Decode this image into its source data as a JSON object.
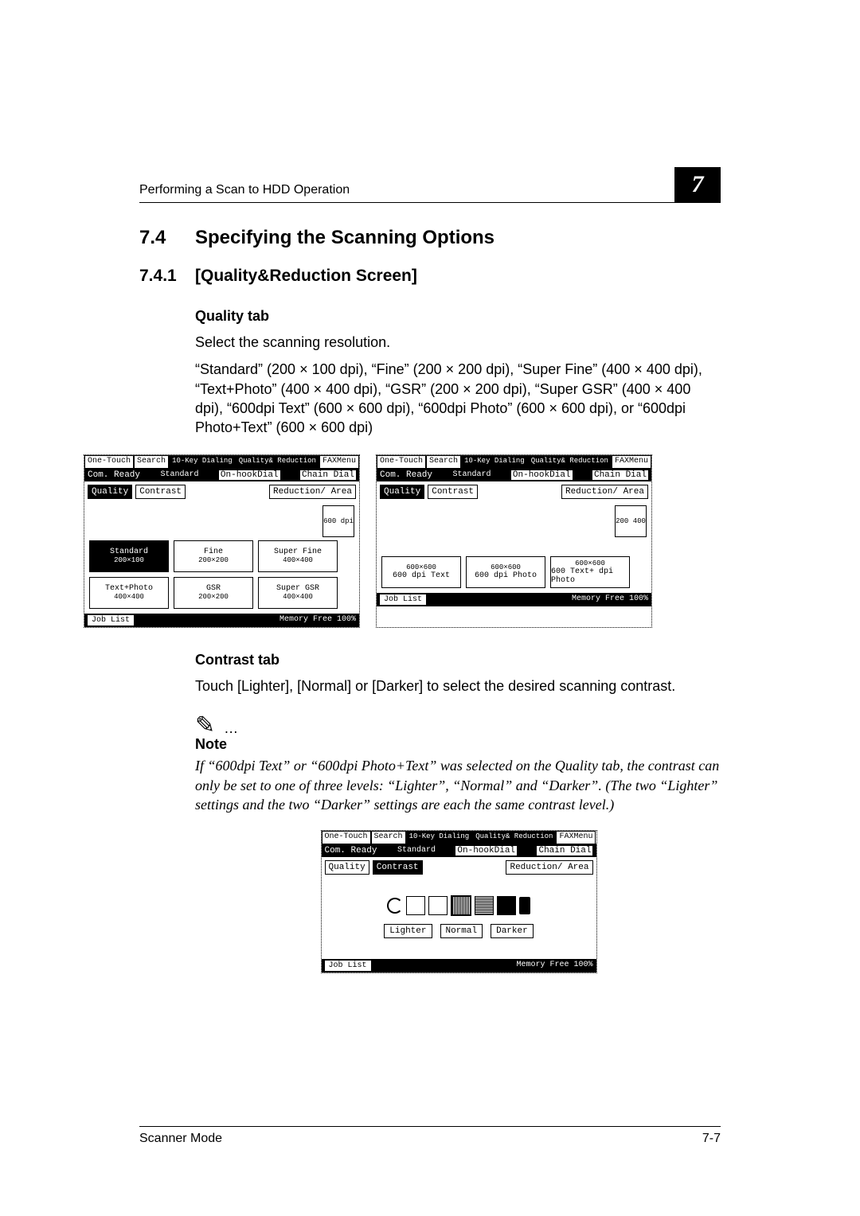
{
  "header": {
    "running_title": "Performing a Scan to HDD Operation",
    "chapter": "7"
  },
  "section": {
    "num": "7.4",
    "title": "Specifying the Scanning Options"
  },
  "subsection": {
    "num": "7.4.1",
    "title": "[Quality&Reduction Screen]"
  },
  "quality": {
    "heading": "Quality tab",
    "intro": "Select the scanning resolution.",
    "body": "“Standard” (200 × 100 dpi), “Fine” (200 × 200 dpi), “Super Fine” (400 × 400 dpi), “Text+Photo” (400 × 400 dpi), “GSR” (200 × 200 dpi), “Super GSR” (400 × 400 dpi), “600dpi Text” (600 × 600 dpi), “600dpi Photo” (600 × 600 dpi), or “600dpi Photo+Text” (600 × 600 dpi)"
  },
  "lcd_common": {
    "tabs": {
      "one_touch": "One-Touch",
      "search": "Search",
      "dialing": "10-Key\nDialing",
      "quality": "Quality&\nReduction",
      "faxmenu": "FAXMenu"
    },
    "status_left": "Com. Ready",
    "status_mid": "Standard",
    "sub1": "On-hookDial",
    "sub2": "Chain Dial",
    "subtabs": {
      "quality": "Quality",
      "contrast": "Contrast",
      "reduction": "Reduction/\nArea"
    },
    "footer_btn": "Job List",
    "footer_right": "Memory\nFree 100%"
  },
  "lcd1": {
    "chip": "600\ndpi",
    "opts": [
      {
        "label": "Standard",
        "sub": "200×100",
        "sel": true
      },
      {
        "label": "Fine",
        "sub": "200×200"
      },
      {
        "label": "Super Fine",
        "sub": "400×400"
      },
      {
        "label": "Text+Photo",
        "sub": "400×400"
      },
      {
        "label": "GSR",
        "sub": "200×200"
      },
      {
        "label": "Super GSR",
        "sub": "400×400"
      }
    ]
  },
  "lcd2": {
    "chip": "200\n400",
    "opts": [
      {
        "label": "600\ndpi Text",
        "sub": "600×600"
      },
      {
        "label": "600\ndpi Photo",
        "sub": "600×600"
      },
      {
        "label": "600 Text+\ndpi  Photo",
        "sub": "600×600"
      }
    ]
  },
  "contrast": {
    "heading": "Contrast tab",
    "body": "Touch [Lighter], [Normal] or [Darker] to select the desired scanning contrast."
  },
  "note": {
    "label": "Note",
    "body": "If “600dpi Text” or “600dpi Photo+Text” was selected on the Quality tab, the contrast can only be set to one of three levels: “Lighter”, “Normal” and “Darker”. (The two “Lighter” settings and the two “Darker” settings are each the same contrast level.)"
  },
  "lcd3": {
    "labels": {
      "lighter": "Lighter",
      "normal": "Normal",
      "darker": "Darker"
    }
  },
  "footer": {
    "left": "Scanner Mode",
    "right": "7-7"
  }
}
